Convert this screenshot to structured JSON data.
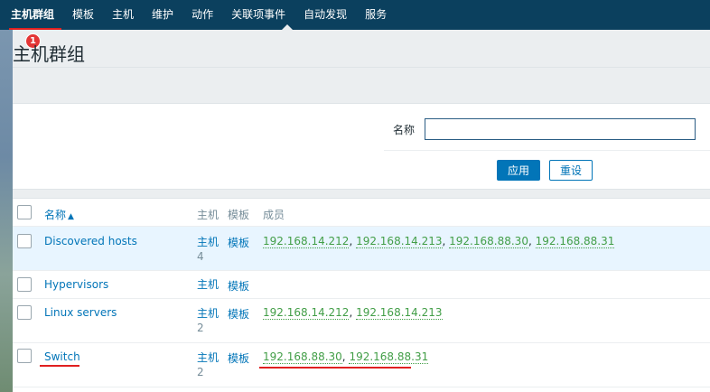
{
  "nav": {
    "items": [
      "主机群组",
      "模板",
      "主机",
      "维护",
      "动作",
      "关联项事件",
      "自动发现",
      "服务"
    ],
    "badge": "1"
  },
  "page": {
    "title": "主机群组"
  },
  "filter": {
    "name_label": "名称",
    "name_value": "",
    "apply_label": "应用",
    "reset_label": "重设"
  },
  "table": {
    "headers": {
      "name": "名称",
      "sort_indicator": "▲",
      "hosts": "主机",
      "templates": "模板",
      "members": "成员"
    },
    "rows": [
      {
        "name": "Discovered hosts",
        "hosts_label": "主机",
        "hosts_count": "4",
        "templates_label": "模板",
        "members": [
          "192.168.14.212",
          "192.168.14.213",
          "192.168.88.30",
          "192.168.88.31"
        ]
      },
      {
        "name": "Hypervisors",
        "hosts_label": "主机",
        "hosts_count": "",
        "templates_label": "模板",
        "members": []
      },
      {
        "name": "Linux servers",
        "hosts_label": "主机",
        "hosts_count": "2",
        "templates_label": "模板",
        "members": [
          "192.168.14.212",
          "192.168.14.213"
        ]
      },
      {
        "name": "Switch",
        "hosts_label": "主机",
        "hosts_count": "2",
        "templates_label": "模板",
        "members": [
          "192.168.88.30",
          "192.168.88.31"
        ]
      }
    ]
  },
  "colors": {
    "nav_bg": "#0b405e",
    "link": "#0275b8",
    "member": "#429e47",
    "highlight_row": "#e8f5ff",
    "annotation_red": "#e02020"
  }
}
